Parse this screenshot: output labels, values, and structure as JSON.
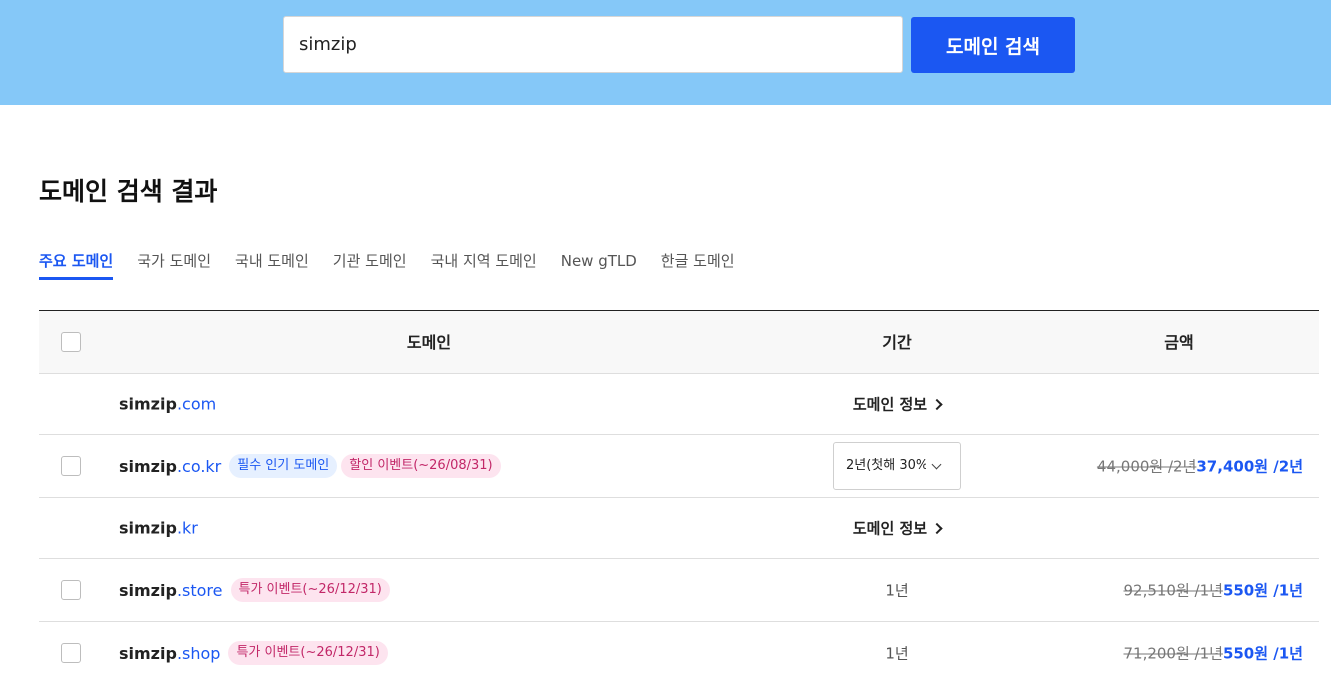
{
  "search": {
    "value": "simzip",
    "button_label": "도메인 검색"
  },
  "page_title": "도메인 검색 결과",
  "tabs": [
    {
      "label": "주요 도메인",
      "active": true
    },
    {
      "label": "국가 도메인",
      "active": false
    },
    {
      "label": "국내 도메인",
      "active": false
    },
    {
      "label": "기관 도메인",
      "active": false
    },
    {
      "label": "국내 지역 도메인",
      "active": false
    },
    {
      "label": "New gTLD",
      "active": false
    },
    {
      "label": "한글 도메인",
      "active": false
    }
  ],
  "table": {
    "headers": {
      "domain": "도메인",
      "period": "기간",
      "price": "금액"
    },
    "rows": [
      {
        "name": "simzip",
        "tld": ".com",
        "domain_info": "도메인 정보"
      },
      {
        "name": "simzip",
        "tld": ".co.kr",
        "badges": [
          "필수 인기 도메인",
          "할인 이벤트(~26/08/31)"
        ],
        "period_select": "2년(첫해 30%",
        "price_old": "44,000원 /2년",
        "price_new": "37,400원 /2년"
      },
      {
        "name": "simzip",
        "tld": ".kr",
        "domain_info": "도메인 정보"
      },
      {
        "name": "simzip",
        "tld": ".store",
        "badges": [
          "특가 이벤트(~26/12/31)"
        ],
        "period": "1년",
        "price_old": "92,510원 /1년",
        "price_new": "550원 /1년"
      },
      {
        "name": "simzip",
        "tld": ".shop",
        "badges": [
          "특가 이벤트(~26/12/31)"
        ],
        "period": "1년",
        "price_old": "71,200원 /1년",
        "price_new": "550원 /1년"
      }
    ]
  },
  "colors": {
    "banner": "#85c8f8",
    "accent": "#1b57f2",
    "badge_pink": "#c22768"
  }
}
